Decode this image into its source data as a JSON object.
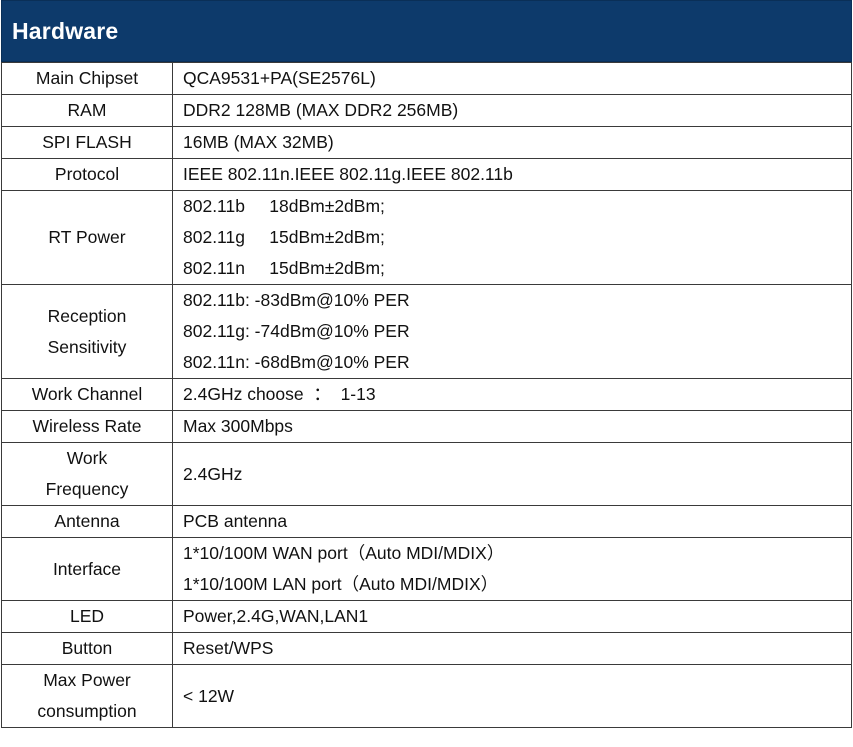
{
  "header": {
    "title": "Hardware"
  },
  "rows": [
    {
      "label": [
        "Main Chipset"
      ],
      "value": [
        "QCA9531+PA(SE2576L)"
      ]
    },
    {
      "label": [
        "RAM"
      ],
      "value": [
        "DDR2 128MB (MAX DDR2 256MB)"
      ]
    },
    {
      "label": [
        "SPI FLASH"
      ],
      "value": [
        "16MB (MAX 32MB)"
      ]
    },
    {
      "label": [
        "Protocol"
      ],
      "value": [
        "IEEE 802.11n.IEEE 802.11g.IEEE 802.11b"
      ]
    },
    {
      "label": [
        "RT Power"
      ],
      "value": [
        "802.11b     18dBm±2dBm;",
        "802.11g     15dBm±2dBm;",
        "802.11n     15dBm±2dBm;"
      ]
    },
    {
      "label": [
        "Reception",
        "Sensitivity"
      ],
      "value": [
        "802.11b: -83dBm@10% PER",
        "802.11g: -74dBm@10% PER",
        "802.11n: -68dBm@10% PER"
      ]
    },
    {
      "label": [
        "Work Channel"
      ],
      "value": [
        "2.4GHz choose  ：  1-13"
      ]
    },
    {
      "label": [
        "Wireless Rate"
      ],
      "value": [
        "Max 300Mbps"
      ]
    },
    {
      "label": [
        "Work",
        "Frequency"
      ],
      "value": [
        "2.4GHz"
      ]
    },
    {
      "label": [
        "Antenna"
      ],
      "value": [
        "PCB antenna"
      ]
    },
    {
      "label": [
        "Interface"
      ],
      "value": [
        "1*10/100M WAN port（Auto MDI/MDIX）",
        "1*10/100M LAN port（Auto MDI/MDIX）"
      ]
    },
    {
      "label": [
        "LED"
      ],
      "value": [
        "Power,2.4G,WAN,LAN1"
      ]
    },
    {
      "label": [
        "Button"
      ],
      "value": [
        "Reset/WPS"
      ]
    },
    {
      "label": [
        "Max Power",
        "consumption"
      ],
      "value": [
        "< 12W"
      ]
    }
  ]
}
